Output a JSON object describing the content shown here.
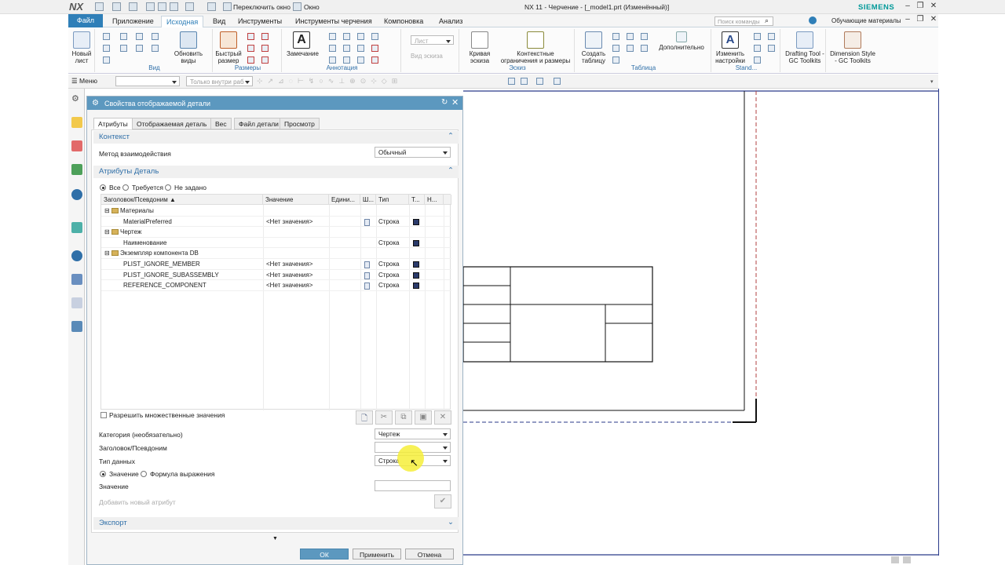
{
  "app": {
    "logo": "NX",
    "title": "NX 11 - Черчение - [_model1.prt (Изменённый)]",
    "brand": "SIEMENS",
    "switch_window": "Переключить окно",
    "window": "Окно",
    "search_placeholder": "Поиск команды",
    "learning": "Обучающие материалы"
  },
  "tabs": [
    "Файл",
    "Приложение",
    "Исходная",
    "Вид",
    "Инструменты",
    "Инструменты черчения",
    "Компоновка",
    "Анализ"
  ],
  "ribbon": {
    "new_sheet": "Новый лист",
    "update_views": "Обновить виды",
    "views_group": "Вид",
    "quick_dim": "Быстрый размер",
    "dims_group": "Размеры",
    "note": "Замечание",
    "annot_group": "Аннотация",
    "sheet_combo": "Лист",
    "sketch_view": "Вид эскиза",
    "curve_sketch": "Кривая эскиза",
    "constraints": "Контекстные ограничения и размеры",
    "sketch_group": "Эскиз",
    "create_table": "Создать таблицу",
    "additional": "Дополнительно",
    "table_group": "Таблица",
    "change_settings": "Изменить настройки",
    "stand_group": "Stand...",
    "drafting_tool": "Drafting Tool - GC Toolkits",
    "dim_style": "Dimension Style - GC Toolkits"
  },
  "toolbar2": {
    "menu": "Меню",
    "filter_placeholder": "Только внутри раб"
  },
  "dialog": {
    "title": "Свойства отображаемой детали",
    "tabs": [
      "Атрибуты",
      "Отображаемая деталь",
      "Вес",
      "Файл детали",
      "Просмотр"
    ],
    "context_section": "Контекст",
    "interaction_label": "Метод взаимодействия",
    "interaction_value": "Обычный",
    "attrs_section": "Атрибуты Деталь",
    "filter_all": "Все",
    "filter_required": "Требуется",
    "filter_unset": "Не задано",
    "columns": [
      "Заголовок/Псевдоним",
      "Значение",
      "Едини...",
      "Ш...",
      "Тип",
      "Т...",
      "Н..."
    ],
    "rows": [
      {
        "kind": "group",
        "title": "Материалы",
        "value": "",
        "type": ""
      },
      {
        "kind": "item",
        "title": "MaterialPreferred",
        "value": "<Нет значения>",
        "type": "Строка"
      },
      {
        "kind": "group",
        "title": "Чертеж",
        "value": "",
        "type": ""
      },
      {
        "kind": "item",
        "title": "Наименование",
        "value": "",
        "type": "Строка"
      },
      {
        "kind": "group",
        "title": "Экземпляр компонента DB",
        "value": "",
        "type": ""
      },
      {
        "kind": "item",
        "title": "PLIST_IGNORE_MEMBER",
        "value": "<Нет значения>",
        "type": "Строка"
      },
      {
        "kind": "item",
        "title": "PLIST_IGNORE_SUBASSEMBLY",
        "value": "<Нет значения>",
        "type": "Строка"
      },
      {
        "kind": "item",
        "title": "REFERENCE_COMPONENT",
        "value": "<Нет значения>",
        "type": "Строка"
      }
    ],
    "allow_multiple": "Разрешить множественные значения",
    "category_label": "Категория (необязательно)",
    "category_value": "Чертеж",
    "title_label": "Заголовок/Псевдоним",
    "title_value": "",
    "datatype_label": "Тип данных",
    "datatype_value": "Строка",
    "mode_value": "Значение",
    "mode_expr": "Формула выражения",
    "value_label": "Значение",
    "value_value": "",
    "add_attr": "Добавить новый атрибут",
    "export_section": "Экспорт",
    "ok": "ОК",
    "apply": "Применить",
    "cancel": "Отмена"
  }
}
